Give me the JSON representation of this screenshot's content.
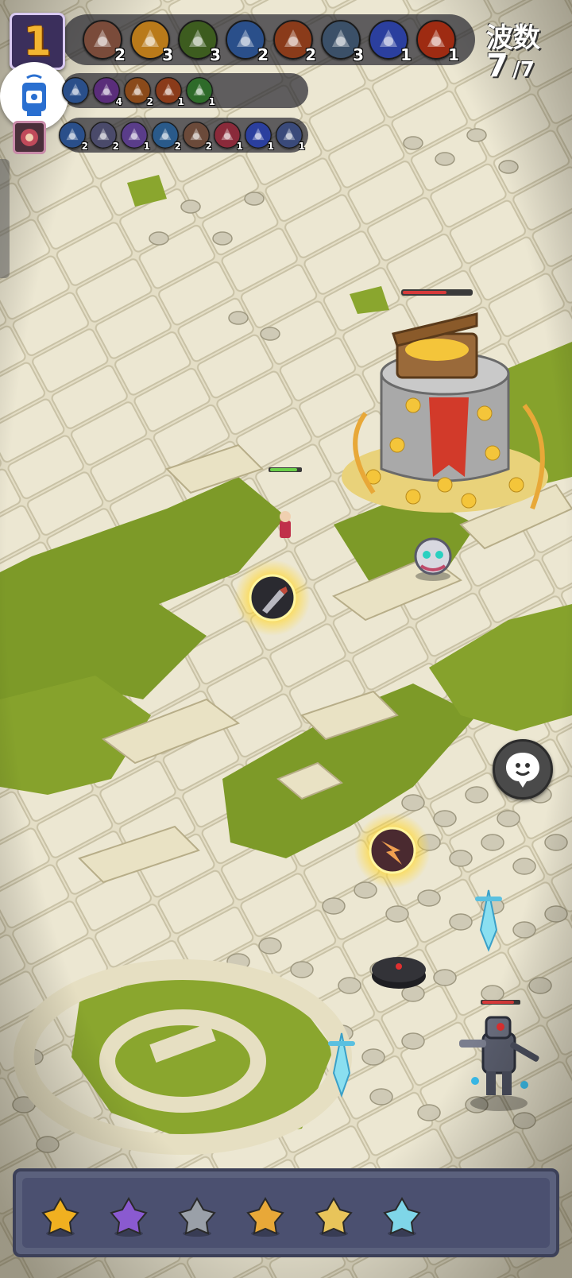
{
  "level_badge": {
    "value": "1"
  },
  "wave": {
    "label": "波数",
    "current": "7",
    "total": "/7"
  },
  "skills_row1": [
    {
      "icon": "skull-orb-icon",
      "level": "2",
      "color": "#7a4b3a"
    },
    {
      "icon": "golden-ring-icon",
      "level": "3",
      "color": "#b97a1a"
    },
    {
      "icon": "green-swirl-icon",
      "level": "3",
      "color": "#3d5c1f"
    },
    {
      "icon": "ice-shards-icon",
      "level": "2",
      "color": "#2a4f8a"
    },
    {
      "icon": "fire-kunai-icon",
      "level": "2",
      "color": "#8a3b1a"
    },
    {
      "icon": "axe-icon",
      "level": "3",
      "color": "#3b5068"
    },
    {
      "icon": "lightning-spear-icon",
      "level": "1",
      "color": "#2b3f9e"
    },
    {
      "icon": "fire-ring-icon",
      "level": "1",
      "color": "#9e2b12"
    }
  ],
  "skills_row2": [
    {
      "icon": "blue-claw-icon",
      "level": "",
      "color": "#2a4f8a"
    },
    {
      "icon": "purple-swirl-icon",
      "level": "4",
      "color": "#5a2d7a"
    },
    {
      "icon": "fire-orb-icon",
      "level": "2",
      "color": "#8a4a1a"
    },
    {
      "icon": "flame-strike-icon",
      "level": "1",
      "color": "#8a3b1a"
    },
    {
      "icon": "green-flame-icon",
      "level": "1",
      "color": "#2e6b2a"
    }
  ],
  "skills_row3": [
    {
      "icon": "ice-claw-icon",
      "level": "2",
      "color": "#2a4f8a"
    },
    {
      "icon": "crescent-moon-icon",
      "level": "2",
      "color": "#4a4a6a"
    },
    {
      "icon": "star-burst-icon",
      "level": "1",
      "color": "#5a3d8a"
    },
    {
      "icon": "water-swirl-icon",
      "level": "2",
      "color": "#2a5a8a"
    },
    {
      "icon": "tornado-icon",
      "level": "2",
      "color": "#6b4a3a"
    },
    {
      "icon": "red-target-icon",
      "level": "1",
      "color": "#8a2a3a"
    },
    {
      "icon": "blue-arrows-icon",
      "level": "1",
      "color": "#2b3f9e"
    },
    {
      "icon": "crossed-blades-icon",
      "level": "1",
      "color": "#3a4a7a"
    }
  ],
  "items": [
    {
      "icon": "star-badge-icon",
      "color": "#f0b020"
    },
    {
      "icon": "purple-bird-icon",
      "color": "#8a5ad0"
    },
    {
      "icon": "round-bomb-icon",
      "color": "#9aa0a8"
    },
    {
      "icon": "golden-claw-icon",
      "color": "#e8a838"
    },
    {
      "icon": "golden-glove-icon",
      "color": "#e8c45a"
    },
    {
      "icon": "ice-staff-icon",
      "color": "#7fd6e8"
    }
  ],
  "colors": {
    "hud_dark": "#28282f",
    "level_gold": "#f3b531",
    "grass": "#7a9a2a",
    "stone": "#e6e0c8"
  }
}
